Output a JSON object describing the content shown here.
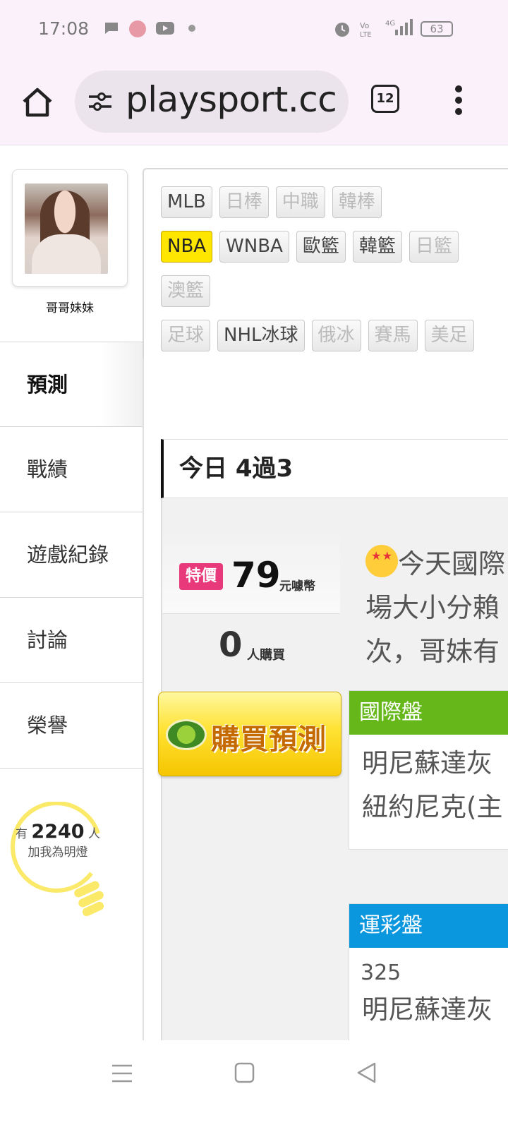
{
  "status_bar": {
    "time": "17:08",
    "battery": "63"
  },
  "browser": {
    "url": "playsport.cc",
    "tab_count": "12"
  },
  "profile": {
    "username": "哥哥妹妹"
  },
  "left_nav": [
    "預測",
    "戰績",
    "遊戲紀錄",
    "討論",
    "榮譽"
  ],
  "fans": {
    "prefix": "有",
    "count": "2240",
    "suffix": "人",
    "subtitle": "加我為明燈"
  },
  "sport_tags": {
    "row1": [
      "MLB",
      "日棒",
      "中職",
      "韓棒"
    ],
    "row2": [
      "NBA",
      "WNBA",
      "歐籃",
      "韓籃",
      "日籃"
    ],
    "row3": [
      "澳籃"
    ],
    "row4": [
      "足球",
      "NHL冰球",
      "俄冰",
      "賽馬",
      "美足"
    ]
  },
  "today": {
    "title": "今日 4過3"
  },
  "offer": {
    "badge": "特價",
    "price": "79",
    "unit": "元噱幣",
    "buyers": "0",
    "buyers_unit": "人購買",
    "buy_button": "購買預測",
    "description_lines": [
      "今天國際",
      "場大小分賴",
      "次，哥妹有"
    ]
  },
  "cards": [
    {
      "title": "國際盤",
      "color": "#66b81a",
      "lines": [
        "明尼蘇達灰",
        "紐約尼克(主"
      ]
    },
    {
      "title": "運彩盤",
      "color": "#0a97dd",
      "number": "325",
      "lines": [
        "明尼蘇達灰"
      ]
    }
  ],
  "colors": {
    "selected_tag": "#ffe600",
    "badge": "#e83a7a"
  }
}
